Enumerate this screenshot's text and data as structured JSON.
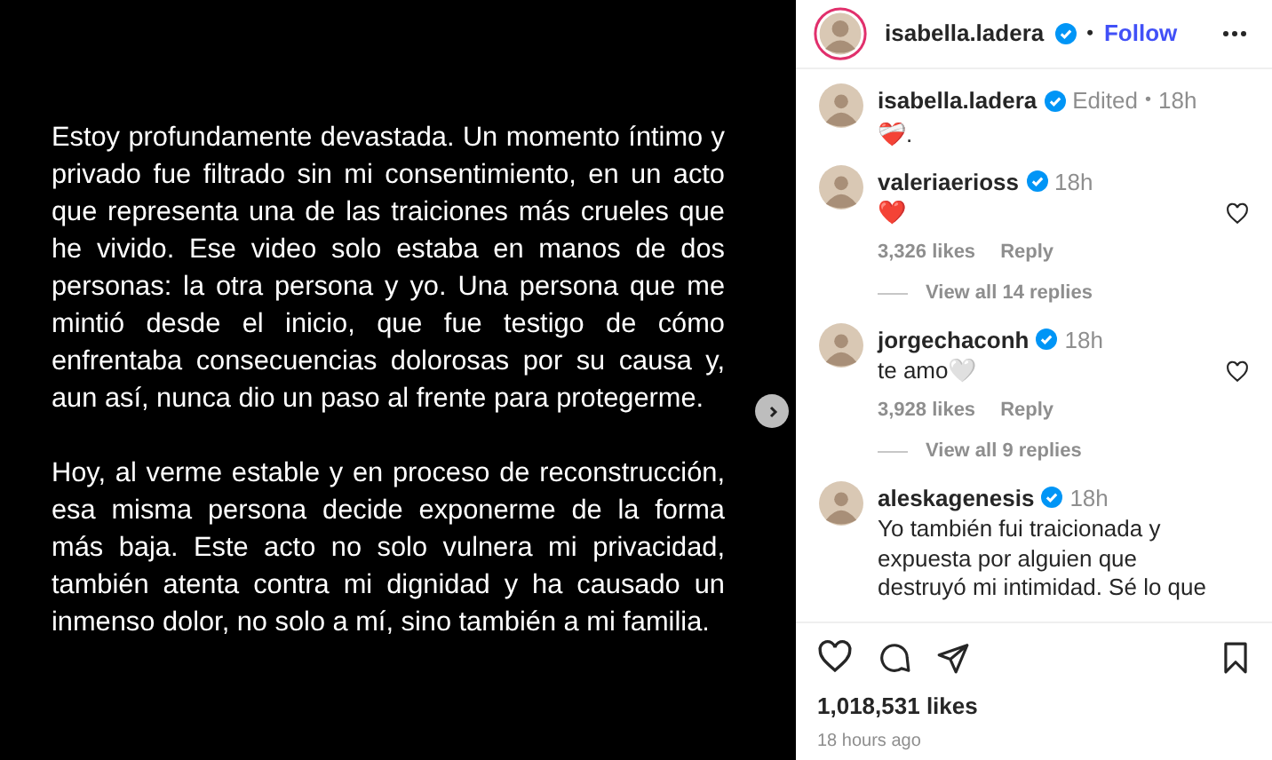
{
  "slide": {
    "paragraphs": [
      "Estoy profundamente devastada. Un momento íntimo y privado fue filtrado sin mi consentimiento, en un acto que representa una de las traiciones más crueles que he vivido. Ese video solo estaba en manos de dos personas: la otra persona y yo. Una persona que me mintió desde el inicio, que fue testigo de cómo enfrentaba consecuencias dolorosas por su causa y, aun así, nunca dio un paso al frente para protegerme.",
      "Hoy, al verme estable y en proceso de reconstrucción, esa misma persona decide exponerme de la forma más baja. Este acto no solo vulnera mi privacidad, también atenta contra mi dignidad y ha causado un inmenso dolor, no solo a mí, sino también a mi familia."
    ]
  },
  "header": {
    "username": "isabella.ladera",
    "verified": true,
    "separator": "•",
    "follow": "Follow"
  },
  "caption": {
    "username": "isabella.ladera",
    "verified": true,
    "edited": "Edited",
    "separator": "•",
    "time": "18h",
    "text": "❤️‍🩹."
  },
  "comments": [
    {
      "username": "valeriaerioss",
      "verified": true,
      "time": "18h",
      "text": "❤️",
      "likes": "3,326 likes",
      "reply": "Reply",
      "view_replies": "View all 14 replies",
      "liked": false
    },
    {
      "username": "jorgechaconh",
      "verified": true,
      "time": "18h",
      "text": "te amo🤍",
      "likes": "3,928 likes",
      "reply": "Reply",
      "view_replies": "View all 9 replies",
      "liked": false
    },
    {
      "username": "aleskagenesis",
      "verified": true,
      "time": "18h",
      "text": "Yo también fui traicionada y expuesta por alguien que destruyó mi intimidad. Sé lo que"
    }
  ],
  "actions": {
    "liked": false,
    "saved": false,
    "likes": "1,018,531 likes",
    "time_ago": "18 hours ago"
  }
}
